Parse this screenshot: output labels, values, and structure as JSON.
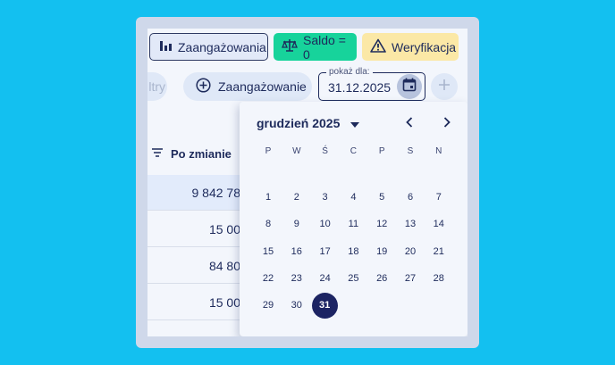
{
  "tabs": {
    "zaangazowania": "Zaangażowania",
    "saldo": "Saldo = 0",
    "weryfikacja": "Weryfikacja"
  },
  "toolbar": {
    "filtry": "ltry",
    "add_label": "Zaangażowanie",
    "date_label": "pokaż dla:",
    "date_value": "31.12.2025"
  },
  "table": {
    "column_header": "Po zmianie",
    "rows": [
      "9 842 78",
      "15 00",
      "84 80",
      "15 00"
    ]
  },
  "calendar": {
    "month_label": "grudzień 2025",
    "weekdays": [
      "P",
      "W",
      "Ś",
      "C",
      "P",
      "S",
      "N"
    ],
    "weeks": [
      [
        "1",
        "2",
        "3",
        "4",
        "5",
        "6",
        "7"
      ],
      [
        "8",
        "9",
        "10",
        "11",
        "12",
        "13",
        "14"
      ],
      [
        "15",
        "16",
        "17",
        "18",
        "19",
        "20",
        "21"
      ],
      [
        "22",
        "23",
        "24",
        "25",
        "26",
        "27",
        "28"
      ],
      [
        "29",
        "30",
        "31",
        "",
        "",
        "",
        ""
      ]
    ],
    "selected_day": "31"
  },
  "colors": {
    "background": "#13c0f0",
    "saldo_tab": "#17d39b",
    "weryfikacja_tab": "#fbe8a6",
    "selected_day": "#1c2463"
  }
}
